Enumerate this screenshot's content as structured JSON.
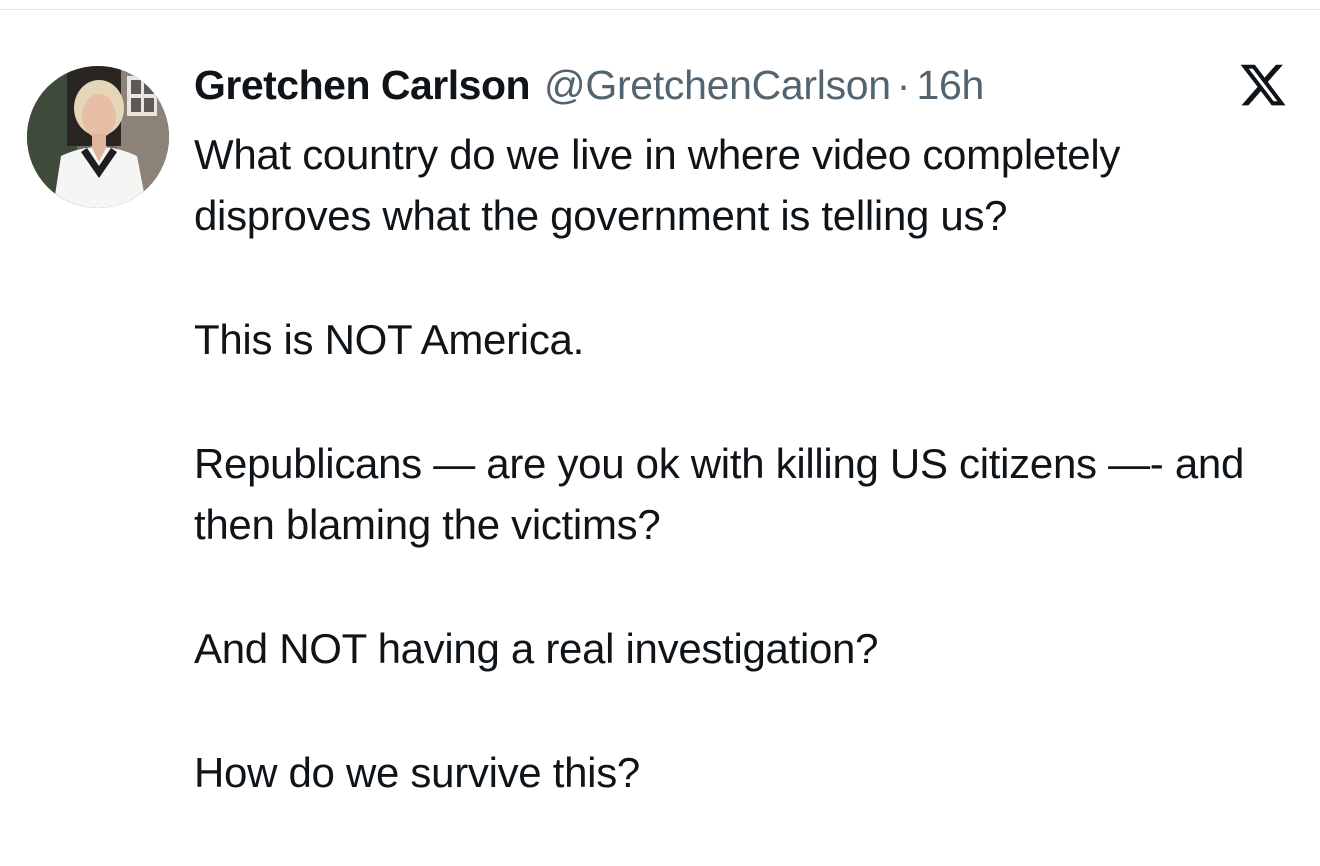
{
  "author": {
    "display_name": "Gretchen Carlson",
    "handle": "@GretchenCarlson",
    "separator": "·",
    "time": "16h",
    "avatar_icon": "profile-photo"
  },
  "platform_icon": "x-logo-icon",
  "tweet": {
    "paragraphs": [
      "What country do we live in where video completely disproves what the government is telling us?",
      "This is NOT America.",
      "Republicans — are you ok with killing US citizens —- and then blaming the victims?",
      "And NOT having a real investigation?",
      "How do we survive this?"
    ]
  },
  "colors": {
    "text_primary": "#0f1419",
    "text_secondary": "#536471",
    "background": "#ffffff"
  }
}
